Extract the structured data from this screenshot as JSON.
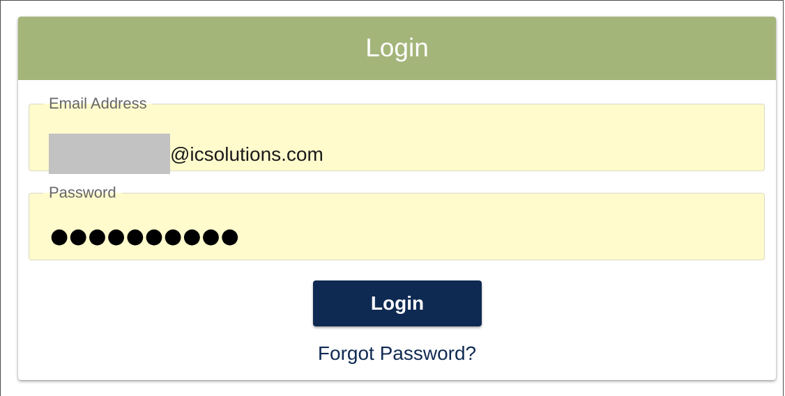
{
  "header": {
    "title": "Login"
  },
  "form": {
    "email": {
      "label": "Email Address",
      "value_suffix": "@icsolutions.com"
    },
    "password": {
      "label": "Password",
      "masked_value": "●●●●●●●●●●"
    },
    "login_button_label": "Login",
    "forgot_password_label": "Forgot Password?"
  },
  "colors": {
    "header_bg": "#a4b57a",
    "field_bg": "#fffbcc",
    "button_bg": "#0f2a52",
    "link_color": "#0f2a52"
  }
}
